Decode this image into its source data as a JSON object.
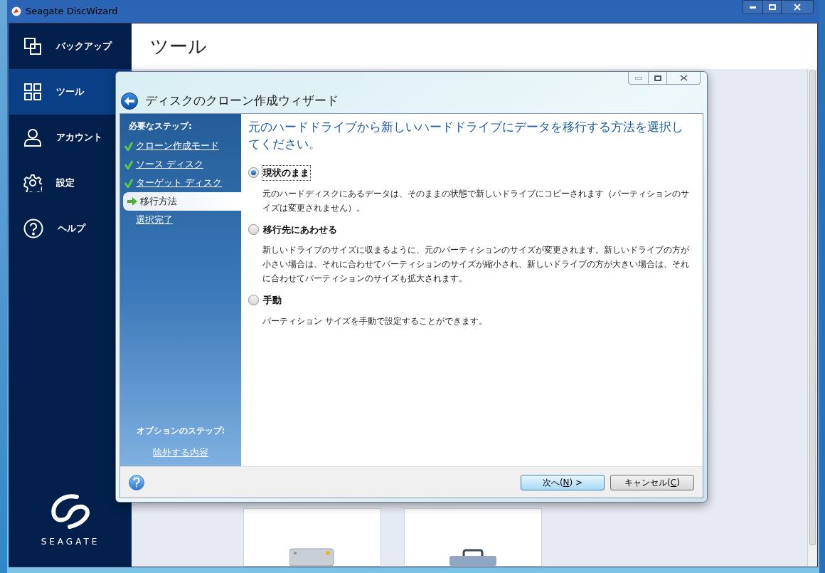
{
  "window": {
    "title": "Seagate DiscWizard"
  },
  "sidebar": {
    "items": [
      {
        "label": "バックアップ",
        "selected": false
      },
      {
        "label": "ツール",
        "selected": true
      },
      {
        "label": "アカウント",
        "selected": false
      },
      {
        "label": "設定",
        "selected": false
      },
      {
        "label": "ヘルプ",
        "selected": false
      }
    ],
    "logo_text": "SEAGATE"
  },
  "page": {
    "title": "ツール"
  },
  "dialog": {
    "title": "ディスクのクローン作成ウィザード",
    "required_heading": "必要なステップ:",
    "steps": [
      {
        "label": "クローン作成モード",
        "kind": "done"
      },
      {
        "label": "ソース ディスク",
        "kind": "done"
      },
      {
        "label": "ターゲット ディスク",
        "kind": "done"
      },
      {
        "label": "移行方法",
        "kind": "current"
      },
      {
        "label": "選択完了",
        "kind": "pending"
      }
    ],
    "optional_heading": "オプションのステップ:",
    "optional_steps": [
      {
        "label": "除外する内容"
      }
    ],
    "question": "元のハードドライブから新しいハードドライブにデータを移行する方法を選択してください。",
    "options": [
      {
        "label": "現状のまま",
        "selected": true,
        "focused": true,
        "description": "元のハードディスクにあるデータは、そのままの状態で新しいドライブにコピーされます（パーティションのサイズは変更されません）。"
      },
      {
        "label": "移行先にあわせる",
        "selected": false,
        "focused": false,
        "description": "新しいドライブのサイズに収まるように、元のパーティションのサイズが変更されます。新しいドライブの方が小さい場合は、それに合わせてパーティションのサイズが縮小され、新しいドライブの方が大きい場合は、それに合わせてパーティションのサイズも拡大されます。"
      },
      {
        "label": "手動",
        "selected": false,
        "focused": false,
        "description": "パーティション サイズを手動で設定することができます。"
      }
    ],
    "buttons": [
      {
        "kind": "primary",
        "text_before": "次へ(",
        "mnemonic": "N",
        "text_after": ") >"
      },
      {
        "kind": "secondary",
        "text_before": "キャンセル(",
        "mnemonic": "C",
        "text_after": ")"
      }
    ]
  }
}
